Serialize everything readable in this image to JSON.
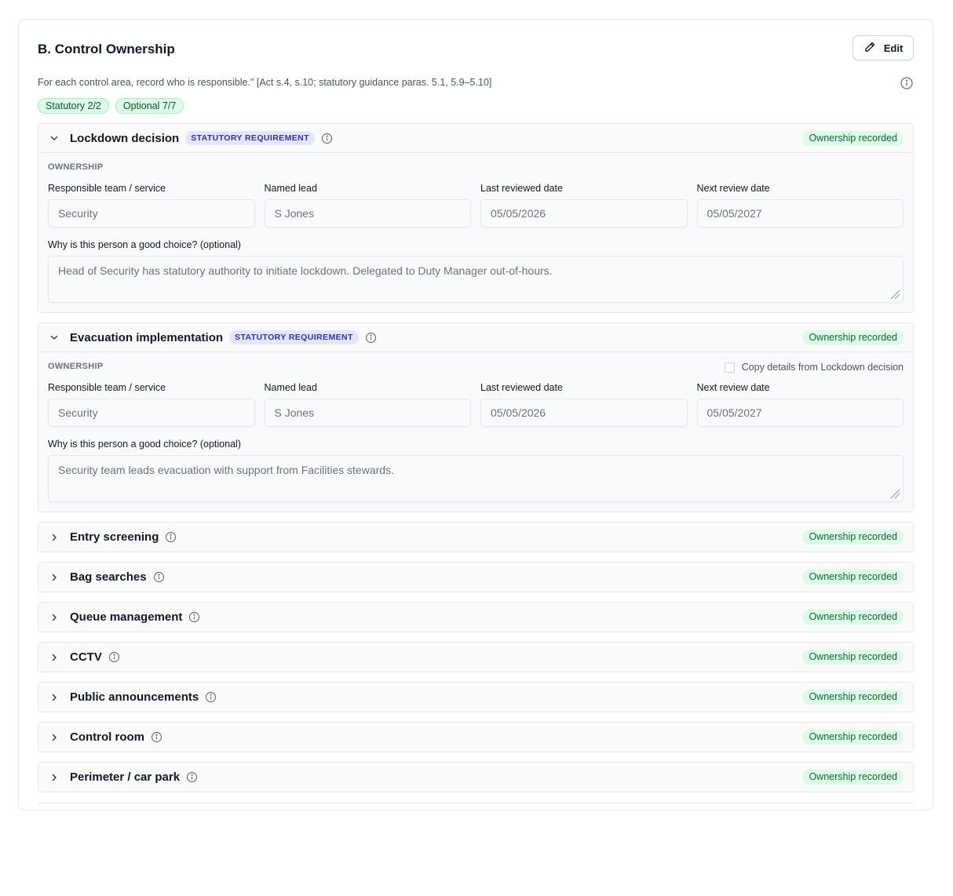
{
  "header": {
    "title": "B. Control Ownership",
    "edit_label": "Edit",
    "description": "For each control area, record who is responsible.\" [Act s.4, s.10; statutory guidance paras. 5.1, 5.9–5.10]"
  },
  "pills": [
    "Statutory 2/2",
    "Optional 7/7"
  ],
  "labels": {
    "ownership": "OWNERSHIP",
    "team": "Responsible team / service",
    "lead": "Named lead",
    "last_reviewed": "Last reviewed date",
    "next_review": "Next review date",
    "why": "Why is this person a good choice? (optional)",
    "statutory": "STATUTORY REQUIREMENT",
    "recorded": "Ownership recorded",
    "copy_from": "Copy details from Lockdown decision"
  },
  "sections": [
    {
      "title": "Lockdown decision",
      "team": "Security",
      "lead": "S Jones",
      "last_reviewed": "05/05/2026",
      "next_review": "05/05/2027",
      "why": "Head of Security has statutory authority to initiate lockdown. Delegated to Duty Manager out-of-hours."
    },
    {
      "title": "Evacuation implementation",
      "team": "Security",
      "lead": "S Jones",
      "last_reviewed": "05/05/2026",
      "next_review": "05/05/2027",
      "why": "Security team leads evacuation with support from Facilities stewards."
    },
    {
      "title": "Entry screening"
    },
    {
      "title": "Bag searches"
    },
    {
      "title": "Queue management"
    },
    {
      "title": "CCTV"
    },
    {
      "title": "Public announcements"
    },
    {
      "title": "Control room"
    },
    {
      "title": "Perimeter / car park"
    }
  ],
  "colors": {
    "accent_green_bg": "#dcfce7",
    "accent_green_text": "#166534",
    "statutory_bg": "#e0e7ff",
    "statutory_text": "#3730a3"
  }
}
